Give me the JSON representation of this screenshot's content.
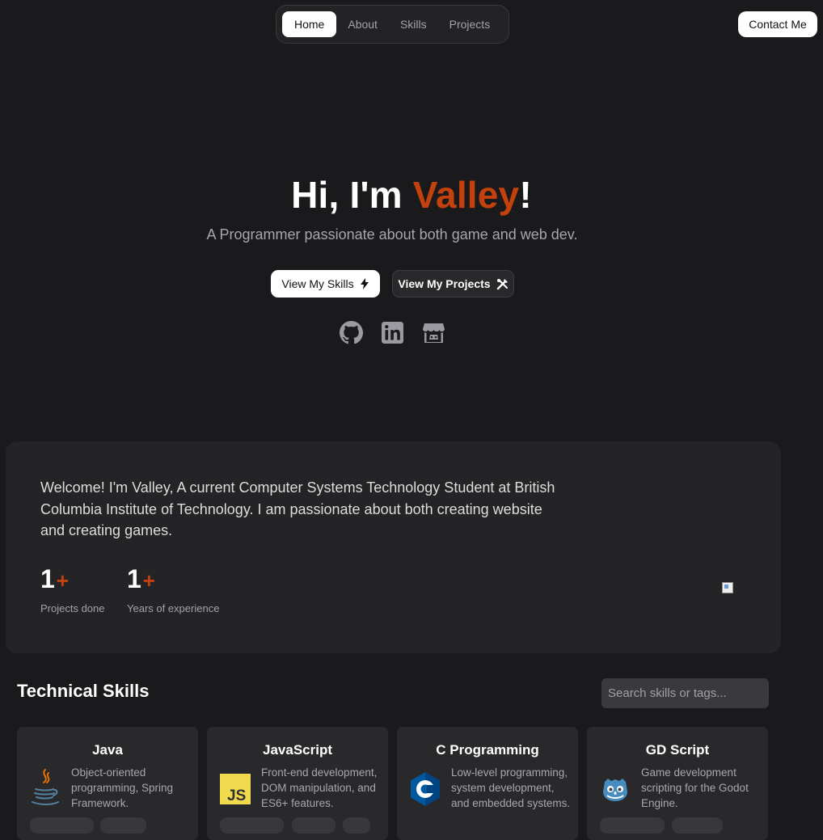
{
  "nav": {
    "items": [
      {
        "label": "Home"
      },
      {
        "label": "About"
      },
      {
        "label": "Skills"
      },
      {
        "label": "Projects"
      }
    ],
    "contact_label": "Contact Me"
  },
  "hero": {
    "title_prefix": "Hi, I'm ",
    "title_name": "Valley",
    "title_suffix": "!",
    "subtitle": "A Programmer passionate about both game and web dev.",
    "skills_button": "View My Skills",
    "projects_button": "View My Projects",
    "socials": [
      "github-icon",
      "linkedin-icon",
      "itchio-icon"
    ]
  },
  "about": {
    "text": "Welcome! I'm Valley, A current Computer Systems Technology Student at British Columbia Institute of Technology. I am passionate about both creating website and creating games.",
    "stats": [
      {
        "number": "1",
        "suffix": "+",
        "label": "Projects done"
      },
      {
        "number": "1",
        "suffix": "+",
        "label": "Years of experience"
      }
    ]
  },
  "skills": {
    "title": "Technical Skills",
    "search_placeholder": "Search skills or tags...",
    "cards": [
      {
        "name": "Java",
        "description": "Object-oriented programming, Spring Framework.",
        "icon": "java-icon"
      },
      {
        "name": "JavaScript",
        "description": "Front-end development, DOM manipulation, and ES6+ features.",
        "icon": "javascript-icon"
      },
      {
        "name": "C Programming",
        "description": "Low-level programming, system development, and embedded systems.",
        "icon": "c-icon"
      },
      {
        "name": "GD Script",
        "description": "Game development scripting for the Godot Engine.",
        "icon": "godot-icon"
      }
    ]
  },
  "colors": {
    "accent": "#c2410c",
    "background": "#1a1a1c",
    "card": "#242427"
  }
}
